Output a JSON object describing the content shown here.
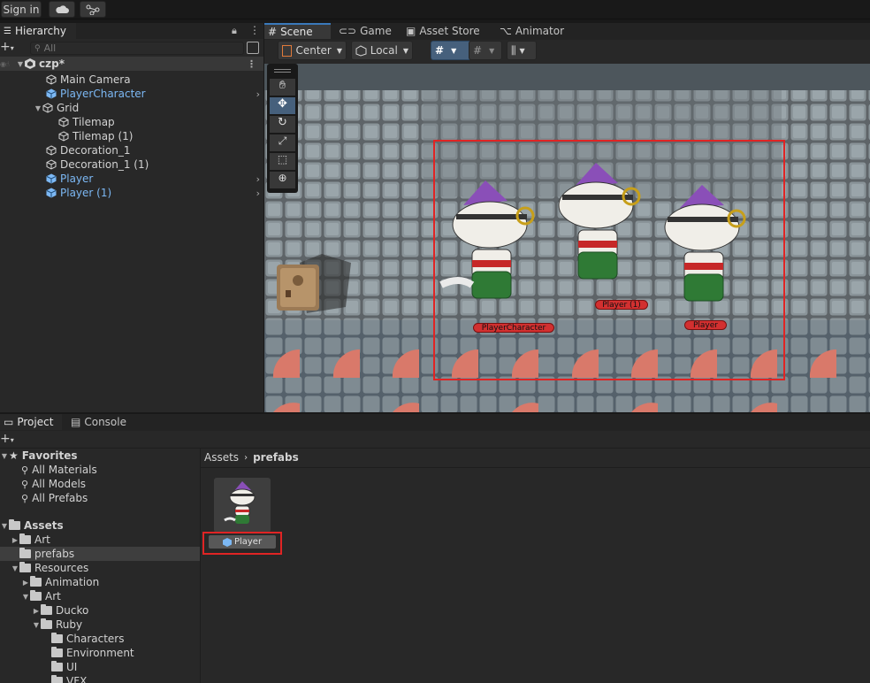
{
  "topbar": {
    "sign_in": "Sign in"
  },
  "hierarchy": {
    "tab": "Hierarchy",
    "search_placeholder": "All",
    "scene": "czp*",
    "items": [
      {
        "label": "Main Camera",
        "blue": false
      },
      {
        "label": "PlayerCharacter",
        "blue": true
      },
      {
        "label": "Grid",
        "blue": false
      },
      {
        "label": "Tilemap",
        "blue": false
      },
      {
        "label": "Tilemap (1)",
        "blue": false
      },
      {
        "label": "Decoration_1",
        "blue": false
      },
      {
        "label": "Decoration_1 (1)",
        "blue": false
      },
      {
        "label": "Player",
        "blue": true
      },
      {
        "label": "Player (1)",
        "blue": true
      }
    ]
  },
  "scene_tabs": {
    "scene": "Scene",
    "game": "Game",
    "asset_store": "Asset Store",
    "animator": "Animator"
  },
  "scene_toolbar": {
    "pivot": "Center",
    "space": "Local"
  },
  "scene_labels": {
    "player_character": "PlayerCharacter",
    "player1": "Player (1)",
    "player": "Player"
  },
  "project": {
    "tab_project": "Project",
    "tab_console": "Console",
    "favorites": "Favorites",
    "fav_items": [
      "All Materials",
      "All Models",
      "All Prefabs"
    ],
    "assets": "Assets",
    "tree": [
      {
        "label": "Art",
        "level": 1,
        "arrow": "right"
      },
      {
        "label": "prefabs",
        "level": 1,
        "arrow": ""
      },
      {
        "label": "Resources",
        "level": 1,
        "arrow": "down"
      },
      {
        "label": "Animation",
        "level": 2,
        "arrow": "right"
      },
      {
        "label": "Art",
        "level": 2,
        "arrow": "down"
      },
      {
        "label": "Ducko",
        "level": 3,
        "arrow": "right"
      },
      {
        "label": "Ruby",
        "level": 3,
        "arrow": "down"
      },
      {
        "label": "Characters",
        "level": 4,
        "arrow": ""
      },
      {
        "label": "Environment",
        "level": 4,
        "arrow": ""
      },
      {
        "label": "UI",
        "level": 4,
        "arrow": ""
      },
      {
        "label": "VFX",
        "level": 4,
        "arrow": ""
      }
    ],
    "breadcrumb_root": "Assets",
    "breadcrumb_current": "prefabs",
    "asset_label": "Player"
  },
  "colors": {
    "accent": "#3a79bb",
    "prefab_blue": "#7cb8f4",
    "selection_red": "#e02424"
  }
}
